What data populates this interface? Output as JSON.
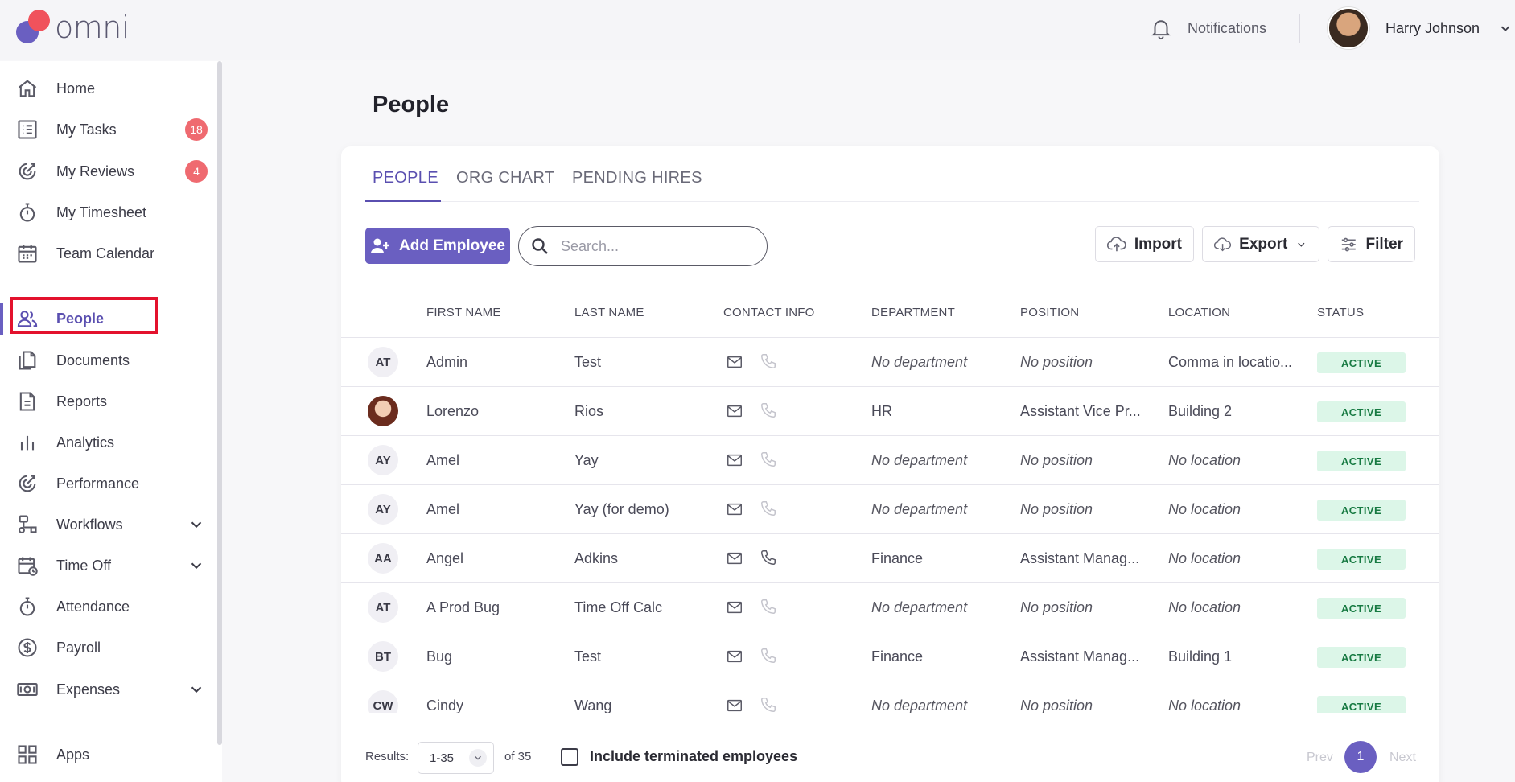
{
  "header": {
    "logo_text": "omni",
    "notifications_label": "Notifications",
    "user_name": "Harry Johnson"
  },
  "sidebar": {
    "items": [
      {
        "label": "Home",
        "icon": "home-icon"
      },
      {
        "label": "My Tasks",
        "icon": "tasks-icon",
        "badge": "18"
      },
      {
        "label": "My Reviews",
        "icon": "reviews-icon",
        "badge": "4"
      },
      {
        "label": "My Timesheet",
        "icon": "stopwatch-icon"
      },
      {
        "label": "Team Calendar",
        "icon": "calendar-icon"
      },
      {
        "label": "People",
        "icon": "people-icon",
        "active": true
      },
      {
        "label": "Documents",
        "icon": "documents-icon"
      },
      {
        "label": "Reports",
        "icon": "report-icon"
      },
      {
        "label": "Analytics",
        "icon": "bar-chart-icon"
      },
      {
        "label": "Performance",
        "icon": "performance-icon"
      },
      {
        "label": "Workflows",
        "icon": "workflow-icon",
        "expandable": true
      },
      {
        "label": "Time Off",
        "icon": "calendar-clock-icon",
        "expandable": true
      },
      {
        "label": "Attendance",
        "icon": "stopwatch-icon"
      },
      {
        "label": "Payroll",
        "icon": "dollar-icon"
      },
      {
        "label": "Expenses",
        "icon": "money-icon",
        "expandable": true
      },
      {
        "label": "Apps",
        "icon": "apps-grid-icon"
      }
    ]
  },
  "main": {
    "page_title": "People",
    "tabs": [
      "PEOPLE",
      "ORG CHART",
      "PENDING HIRES"
    ],
    "active_tab": "PEOPLE",
    "add_employee_label": "Add Employee",
    "search_placeholder": "Search...",
    "import_label": "Import",
    "export_label": "Export",
    "filter_label": "Filter"
  },
  "table": {
    "columns": [
      "FIRST NAME",
      "LAST NAME",
      "CONTACT INFO",
      "DEPARTMENT",
      "POSITION",
      "LOCATION",
      "STATUS"
    ],
    "rows": [
      {
        "initials": "AT",
        "first": "Admin",
        "last": "Test",
        "phone": false,
        "department": "No department",
        "position": "No position",
        "location": "Comma in locatio...",
        "status": "ACTIVE"
      },
      {
        "initials": "",
        "photo": true,
        "first": "Lorenzo",
        "last": "Rios",
        "phone": false,
        "department": "HR",
        "position": "Assistant Vice Pr...",
        "location": "Building 2",
        "status": "ACTIVE"
      },
      {
        "initials": "AY",
        "first": "Amel",
        "last": "Yay",
        "phone": false,
        "department": "No department",
        "position": "No position",
        "location": "No location",
        "status": "ACTIVE"
      },
      {
        "initials": "AY",
        "first": "Amel",
        "last": "Yay (for demo)",
        "phone": false,
        "department": "No department",
        "position": "No position",
        "location": "No location",
        "status": "ACTIVE"
      },
      {
        "initials": "AA",
        "first": "Angel",
        "last": "Adkins",
        "phone": true,
        "department": "Finance",
        "position": "Assistant Manag...",
        "location": "No location",
        "status": "ACTIVE"
      },
      {
        "initials": "AT",
        "first": "A Prod Bug",
        "last": "Time Off Calc",
        "phone": false,
        "department": "No department",
        "position": "No position",
        "location": "No location",
        "status": "ACTIVE"
      },
      {
        "initials": "BT",
        "first": "Bug",
        "last": "Test",
        "phone": false,
        "department": "Finance",
        "position": "Assistant Manag...",
        "location": "Building 1",
        "status": "ACTIVE"
      },
      {
        "initials": "CW",
        "first": "Cindy",
        "last": "Wang",
        "phone": false,
        "department": "No department",
        "position": "No position",
        "location": "No location",
        "status": "ACTIVE"
      }
    ]
  },
  "footer": {
    "results_label": "Results:",
    "results_range": "1-35",
    "of_total": "of 35",
    "include_terminated_label": "Include terminated employees",
    "prev_label": "Prev",
    "current_page": "1",
    "next_label": "Next"
  },
  "colors": {
    "accent": "#6a5fc1",
    "badge": "#ef6a70",
    "status_bg": "#dcf6e8",
    "status_text": "#177a42",
    "highlight": "#e3122d"
  }
}
